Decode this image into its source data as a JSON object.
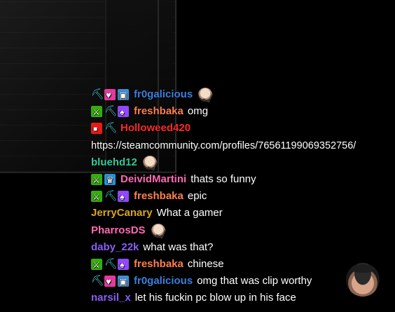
{
  "colors": {
    "background": "#000000",
    "message_text": "#ffffff"
  },
  "chat": {
    "messages": [
      {
        "badges": [
          "pickaxe-icon",
          "heart-badge-icon",
          "gift-badge-icon"
        ],
        "user": "fr0galicious",
        "user_color": "#3b7fdc",
        "text": "",
        "emote": "thinking-face-emote"
      },
      {
        "badges": [
          "moderator-sword-icon",
          "pickaxe-icon",
          "subscriber-badge-icon"
        ],
        "user": "freshbaka",
        "user_color": "#ff7f50",
        "text": "omg"
      },
      {
        "badges": [
          "recording-badge-icon",
          "pickaxe-icon"
        ],
        "user": "Holloweed420",
        "user_color": "#ff2a2a",
        "text": ""
      },
      {
        "badges": [],
        "user": "",
        "user_color": "#ffffff",
        "text": "https://steamcommunity.com/profiles/76561199069352756/",
        "is_url": true
      },
      {
        "badges": [],
        "user": "bluehd12",
        "user_color": "#2ecc9a",
        "text": "",
        "emote": "thinking-face-emote"
      },
      {
        "badges": [
          "moderator-sword-icon",
          "crown-badge-icon"
        ],
        "user": "DeividMartini",
        "user_color": "#ff69b4",
        "text": "thats so funny"
      },
      {
        "badges": [
          "moderator-sword-icon",
          "pickaxe-icon",
          "subscriber-badge-icon"
        ],
        "user": "freshbaka",
        "user_color": "#ff7f50",
        "text": "epic"
      },
      {
        "badges": [],
        "user": "JerryCanary",
        "user_color": "#daa520",
        "text": "What a gamer"
      },
      {
        "badges": [],
        "user": "PharrosDS",
        "user_color": "#ff69b4",
        "text": "",
        "emote": "thinking-face-emote"
      },
      {
        "badges": [],
        "user": "daby_22k",
        "user_color": "#8a5cf5",
        "text": "what was that?"
      },
      {
        "badges": [
          "moderator-sword-icon",
          "pickaxe-icon",
          "subscriber-badge-icon"
        ],
        "user": "freshbaka",
        "user_color": "#ff7f50",
        "text": "chinese"
      },
      {
        "badges": [
          "pickaxe-icon",
          "heart-badge-icon",
          "gift-badge-icon"
        ],
        "user": "fr0galicious",
        "user_color": "#3b7fdc",
        "text": "omg that was clip worthy"
      },
      {
        "badges": [],
        "user": "narsil_x",
        "user_color": "#8a5cf5",
        "text": "let his fuckin pc blow up in his face"
      }
    ]
  },
  "streamer": {
    "avatar_icon": "streamer-face-avatar"
  }
}
